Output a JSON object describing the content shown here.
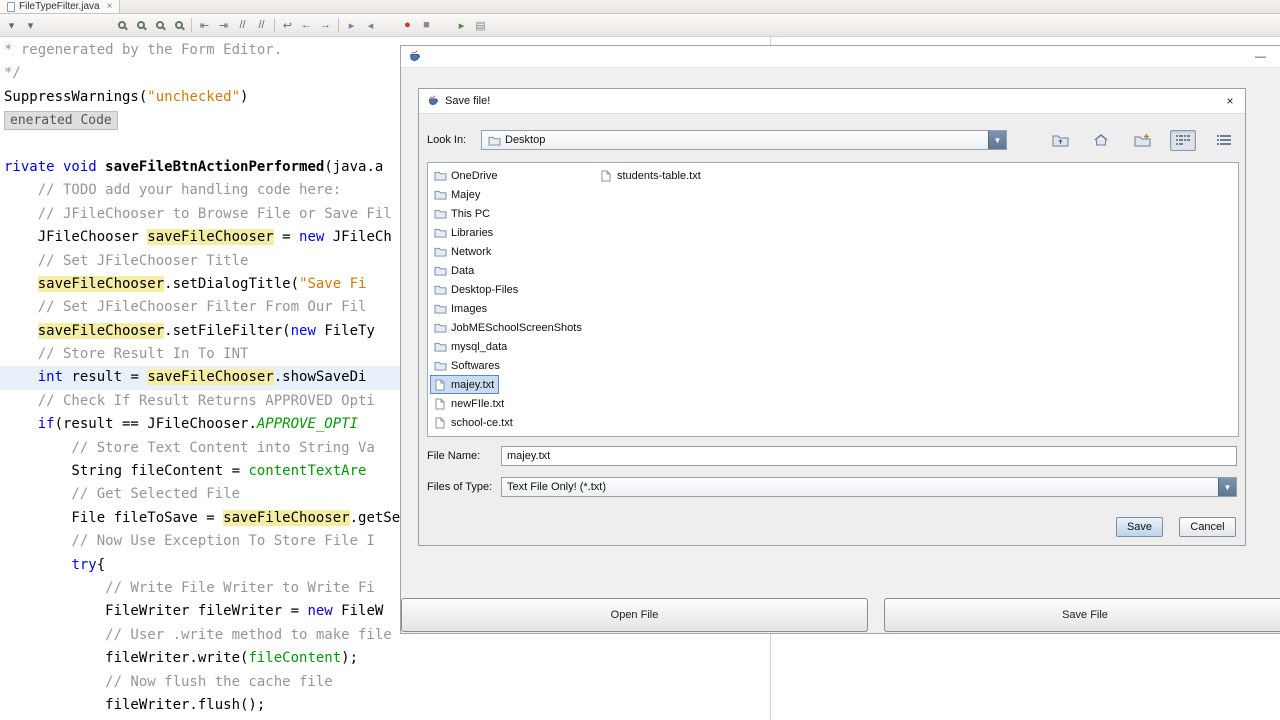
{
  "colors": {
    "occurrence_highlight": "#F4EDA3",
    "caret_line": "#E8F1FB",
    "list_selection": "#C8DCF4",
    "keyword": "#0000E6",
    "comment": "#969696",
    "string": "#CE7B00",
    "field": "#009900"
  },
  "ide": {
    "tab": {
      "title": "FileTypeFilter.java",
      "close_glyph": "×"
    },
    "toolbar": [
      {
        "name": "back-dropdown",
        "glyph": "▾"
      },
      {
        "name": "forward-dropdown",
        "glyph": "▾"
      },
      {
        "gap": 72
      },
      {
        "name": "find-selection-icon",
        "mag": true
      },
      {
        "name": "find-next-icon",
        "mag": true
      },
      {
        "name": "find-previous-icon",
        "mag": true
      },
      {
        "name": "highlight-matches-icon",
        "mag": true
      },
      {
        "sep": true
      },
      {
        "name": "shift-left-icon",
        "glyph": "⇤"
      },
      {
        "name": "shift-right-icon",
        "glyph": "⇥"
      },
      {
        "name": "comment-lines-icon",
        "glyph": "//"
      },
      {
        "name": "uncomment-lines-icon",
        "glyph": "//"
      },
      {
        "sep": true
      },
      {
        "name": "last-edit-icon",
        "glyph": "↩"
      },
      {
        "name": "back-icon",
        "glyph": "←"
      },
      {
        "name": "forward-icon",
        "glyph": "→"
      },
      {
        "sep": true
      },
      {
        "name": "next-bookmark-icon",
        "glyph": "▸",
        "color": "#6D86A8"
      },
      {
        "name": "previous-bookmark-icon",
        "glyph": "◂",
        "color": "#6D86A8"
      },
      {
        "gap": 18
      },
      {
        "name": "record-macro-icon",
        "glyph": "●",
        "color": "#C0392B"
      },
      {
        "name": "stop-macro-icon",
        "glyph": "■",
        "color": "#8A8A8A"
      },
      {
        "gap": 16
      },
      {
        "name": "run-selection-icon",
        "glyph": "▸",
        "color": "#4C8A3F"
      },
      {
        "name": "memory-view-icon",
        "glyph": "▤",
        "color": "#8A8A8A"
      }
    ]
  },
  "editor": {
    "lines": [
      {
        "seg": [
          [
            "c",
            "* regenerated by the Form Editor."
          ]
        ]
      },
      {
        "seg": [
          [
            "c",
            "*/"
          ]
        ]
      },
      {
        "seg": [
          [
            "p",
            "SuppressWarnings("
          ],
          [
            "s",
            "\"unchecked\""
          ],
          [
            "p",
            ")"
          ]
        ]
      },
      {
        "fold": "enerated Code"
      },
      {
        "seg": []
      },
      {
        "seg": [
          [
            "k",
            "rivate void "
          ],
          [
            "b",
            "saveFileBtnActionPerformed"
          ],
          [
            "p",
            "(java.a"
          ]
        ]
      },
      {
        "seg": [
          [
            "c",
            "    // TODO add your handling code here:"
          ]
        ]
      },
      {
        "seg": [
          [
            "c",
            "    // JFileChooser to Browse File or Save Fil"
          ]
        ]
      },
      {
        "seg": [
          [
            "p",
            "    JFileChooser "
          ],
          [
            "h",
            "saveFileChooser"
          ],
          [
            "p",
            " = "
          ],
          [
            "k",
            "new"
          ],
          [
            "p",
            " JFileCh"
          ]
        ]
      },
      {
        "seg": [
          [
            "c",
            "    // Set JFileChooser Title"
          ]
        ]
      },
      {
        "seg": [
          [
            "p",
            "    "
          ],
          [
            "h",
            "saveFileChooser"
          ],
          [
            "p",
            ".setDialogTitle("
          ],
          [
            "s",
            "\"Save Fi"
          ]
        ]
      },
      {
        "seg": [
          [
            "c",
            "    // Set JFileChooser Filter From Our Fil"
          ]
        ]
      },
      {
        "seg": [
          [
            "p",
            "    "
          ],
          [
            "h",
            "saveFileChooser"
          ],
          [
            "p",
            ".setFileFilter("
          ],
          [
            "k",
            "new"
          ],
          [
            "p",
            " FileTy"
          ]
        ]
      },
      {
        "seg": [
          [
            "c",
            "    // Store Result In To INT"
          ]
        ]
      },
      {
        "caret": true,
        "seg": [
          [
            "p",
            "    "
          ],
          [
            "k",
            "int"
          ],
          [
            "p",
            " result = "
          ],
          [
            "h",
            "saveFileChooser"
          ],
          [
            "p",
            ".showSaveDi"
          ]
        ]
      },
      {
        "seg": [
          [
            "c",
            "    // Check If Result Returns APPROVED Opti"
          ]
        ]
      },
      {
        "seg": [
          [
            "p",
            "    "
          ],
          [
            "k",
            "if"
          ],
          [
            "p",
            "(result == JFileChooser."
          ],
          [
            "i",
            "APPROVE_OPTI"
          ]
        ]
      },
      {
        "seg": [
          [
            "c",
            "        // Store Text Content into String Va"
          ]
        ]
      },
      {
        "seg": [
          [
            "p",
            "        String fileContent = "
          ],
          [
            "f",
            "contentTextAre"
          ]
        ]
      },
      {
        "seg": [
          [
            "c",
            "        // Get Selected File"
          ]
        ]
      },
      {
        "seg": [
          [
            "p",
            "        File fileToSave = "
          ],
          [
            "h",
            "saveFileChooser"
          ],
          [
            "p",
            ".getSe"
          ]
        ]
      },
      {
        "seg": [
          [
            "c",
            "        // Now Use Exception To Store File I"
          ]
        ]
      },
      {
        "seg": [
          [
            "p",
            "        "
          ],
          [
            "k",
            "try"
          ],
          [
            "p",
            "{"
          ]
        ]
      },
      {
        "seg": [
          [
            "c",
            "            // Write File Writer to Write Fi"
          ]
        ]
      },
      {
        "seg": [
          [
            "p",
            "            FileWriter fileWriter = "
          ],
          [
            "k",
            "new"
          ],
          [
            "p",
            " FileW"
          ]
        ]
      },
      {
        "seg": [
          [
            "c",
            "            // User .write method to make file"
          ]
        ]
      },
      {
        "seg": [
          [
            "p",
            "            fileWriter.write("
          ],
          [
            "f",
            "fileContent"
          ],
          [
            "p",
            ");"
          ]
        ]
      },
      {
        "seg": [
          [
            "c",
            "            // Now flush the cache file"
          ]
        ]
      },
      {
        "seg": [
          [
            "p",
            "            fileWriter.flush();"
          ]
        ]
      }
    ]
  },
  "frame": {
    "minimize_glyph": "—",
    "open_file_button": "Open File",
    "save_file_button": "Save File"
  },
  "dialog": {
    "title": "Save file!",
    "close_glyph": "×",
    "combo_arrow_glyph": "▼",
    "look_in": {
      "label": "Look In:",
      "value": "Desktop"
    },
    "chooser_buttons": [
      {
        "name": "up-folder-button"
      },
      {
        "name": "home-button"
      },
      {
        "name": "new-folder-button"
      },
      {
        "name": "list-view-button",
        "active": true
      },
      {
        "name": "details-view-button"
      }
    ],
    "file_list": {
      "columns": [
        [
          {
            "label": "OneDrive",
            "type": "folder"
          },
          {
            "label": "Majey",
            "type": "folder"
          },
          {
            "label": "This PC",
            "type": "folder"
          },
          {
            "label": "Libraries",
            "type": "folder"
          },
          {
            "label": "Network",
            "type": "folder"
          },
          {
            "label": "Data",
            "type": "folder"
          },
          {
            "label": "Desktop-Files",
            "type": "folder"
          },
          {
            "label": "Images",
            "type": "folder"
          },
          {
            "label": "JobMESchoolScreenShots",
            "type": "folder"
          },
          {
            "label": "mysql_data",
            "type": "folder"
          },
          {
            "label": "Softwares",
            "type": "folder"
          },
          {
            "label": "majey.txt",
            "type": "file",
            "selected": true
          },
          {
            "label": "newFIle.txt",
            "type": "file"
          },
          {
            "label": "school-ce.txt",
            "type": "file"
          }
        ],
        [
          {
            "label": "students-table.txt",
            "type": "file"
          }
        ]
      ]
    },
    "file_name": {
      "label": "File Name:",
      "value": "majey.txt"
    },
    "files_of_type": {
      "label": "Files of Type:",
      "value": "Text File Only! (*.txt)"
    },
    "buttons": {
      "save": "Save",
      "cancel": "Cancel"
    }
  }
}
